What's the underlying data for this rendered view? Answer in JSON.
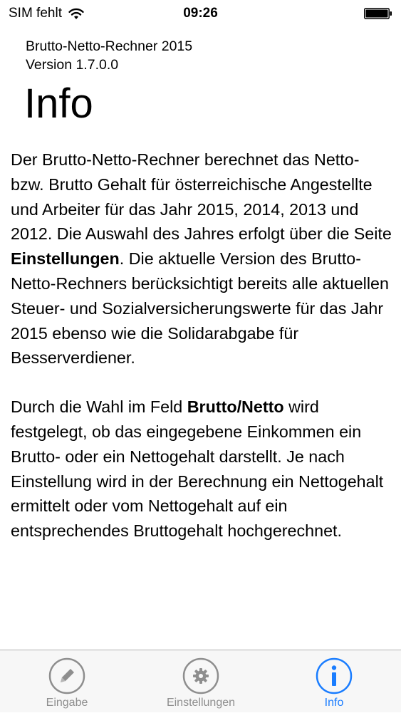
{
  "status_bar": {
    "carrier": "SIM fehlt",
    "time": "09:26",
    "wifi_icon": "wifi-icon",
    "battery_icon": "battery-icon"
  },
  "header": {
    "app_name": "Brutto-Netto-Rechner 2015",
    "version": "Version 1.7.0.0",
    "title": "Info"
  },
  "content": {
    "p1_a": "Der Brutto-Netto-Rechner berechnet das Netto- bzw. Brutto Gehalt für österreichische Angestellte und Arbeiter für das Jahr 2015, 2014, 2013 und 2012. Die Auswahl des Jahres erfolgt über die Seite ",
    "p1_bold": "Einstellungen",
    "p1_b": ". Die aktuelle Version des Brutto-Netto-Rechners berücksichtigt bereits alle aktuellen Steuer- und Sozialversicherungswerte für das Jahr 2015 ebenso wie die Solidarabgabe für Besserverdiener.",
    "p2_a": "Durch die Wahl im Feld ",
    "p2_bold": "Brutto/Netto",
    "p2_b": " wird festgelegt, ob das eingegebene Einkommen ein Brutto- oder ein Nettogehalt darstellt. Je nach Einstellung wird in der Berechnung ein Nettogehalt ermittelt oder vom Nettogehalt auf ein entsprechendes Bruttogehalt hochgerechnet."
  },
  "tab_bar": {
    "tabs": [
      {
        "label": "Eingabe",
        "icon": "pencil-icon",
        "active": false
      },
      {
        "label": "Einstellungen",
        "icon": "gear-icon",
        "active": false
      },
      {
        "label": "Info",
        "icon": "info-icon",
        "active": true
      }
    ]
  },
  "colors": {
    "active_tab": "#1a7dff",
    "inactive_tab": "#8e8e8e",
    "tab_bar_bg": "#f7f7f7"
  }
}
